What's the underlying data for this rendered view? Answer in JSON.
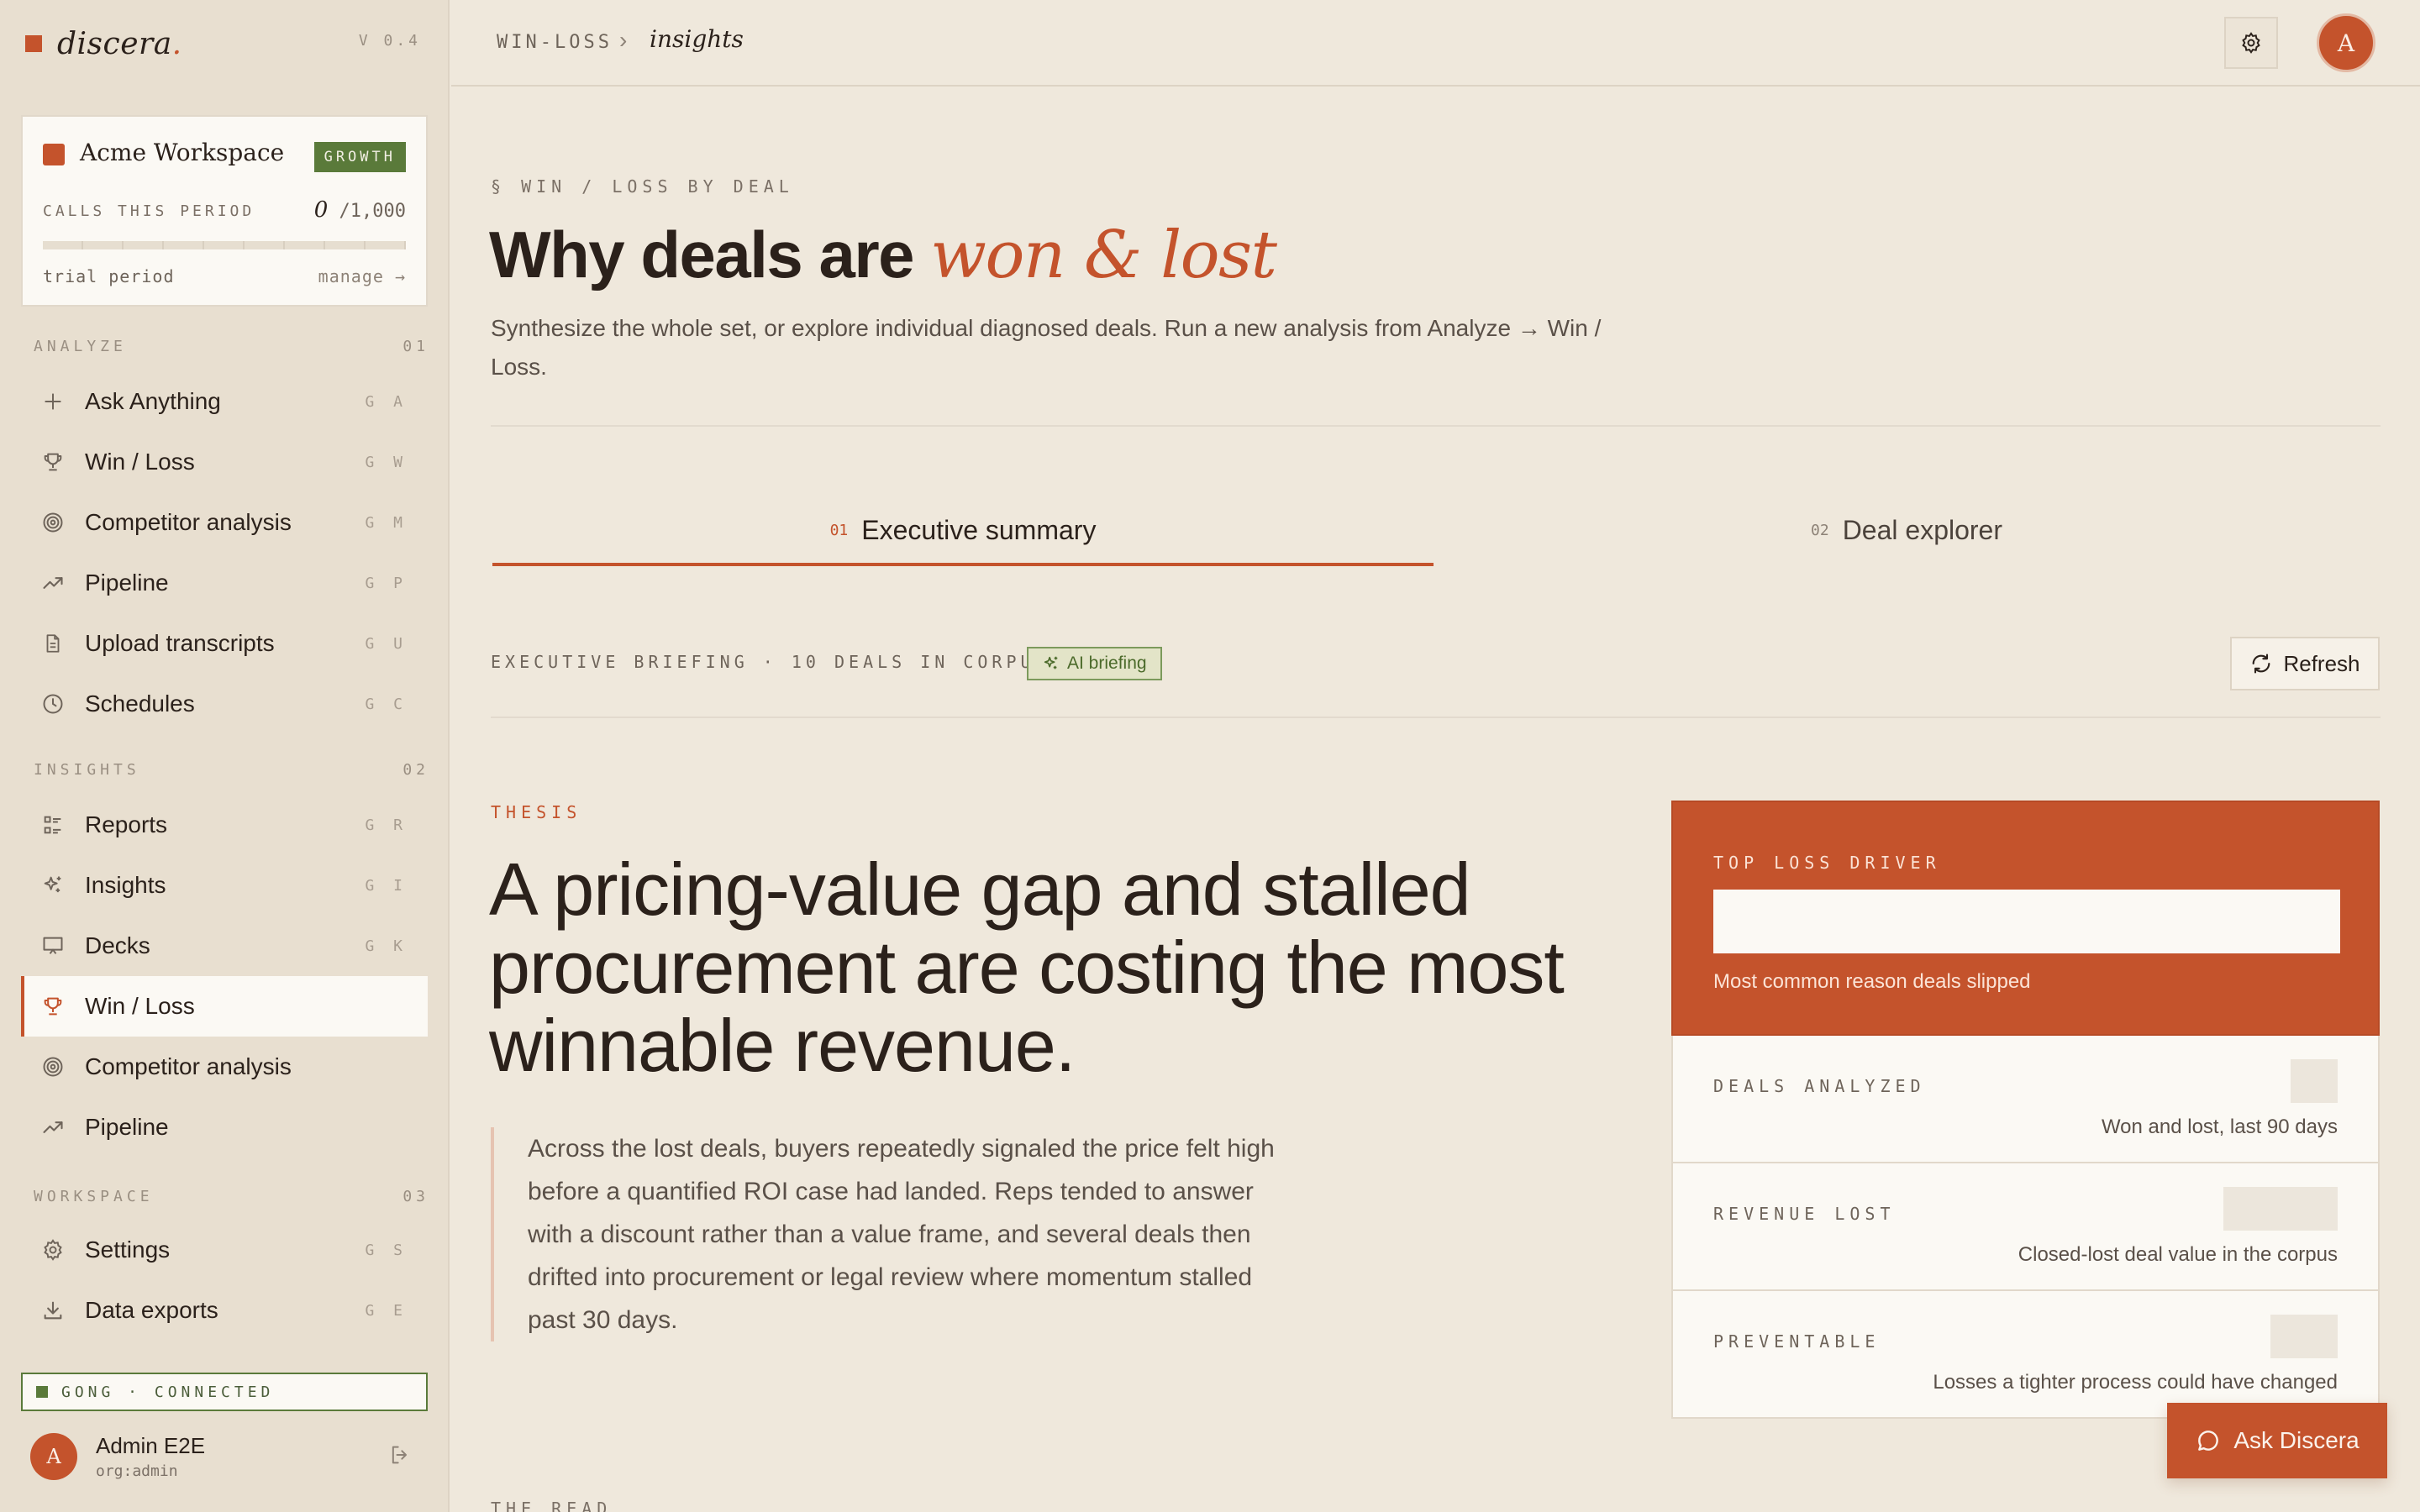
{
  "brand": {
    "name": "discera",
    "dot": ".",
    "version": "V 0.4"
  },
  "workspace": {
    "name": "Acme Workspace",
    "plan": "GROWTH",
    "calls_label": "CALLS THIS PERIOD",
    "calls_used": "0",
    "calls_limit": "/1,000",
    "calls_fraction": 0,
    "trial": "trial period",
    "manage": "manage →"
  },
  "sidebar": {
    "sections": [
      {
        "title": "ANALYZE",
        "num": "01"
      },
      {
        "title": "INSIGHTS",
        "num": "02"
      },
      {
        "title": "WORKSPACE",
        "num": "03"
      }
    ],
    "items": [
      {
        "label": "Ask Anything",
        "key": "G A",
        "icon": "plus-icon"
      },
      {
        "label": "Win / Loss",
        "key": "G W",
        "icon": "trophy-icon"
      },
      {
        "label": "Competitor analysis",
        "key": "G M",
        "icon": "target-icon"
      },
      {
        "label": "Pipeline",
        "key": "G P",
        "icon": "trend-up-icon"
      },
      {
        "label": "Upload transcripts",
        "key": "G U",
        "icon": "document-icon"
      },
      {
        "label": "Schedules",
        "key": "G C",
        "icon": "clock-icon"
      },
      {
        "label": "Reports",
        "key": "G R",
        "icon": "list-icon"
      },
      {
        "label": "Insights",
        "key": "G I",
        "icon": "sparkle-icon"
      },
      {
        "label": "Decks",
        "key": "G K",
        "icon": "presentation-icon"
      },
      {
        "label": "Win / Loss",
        "key": "",
        "icon": "trophy-icon",
        "active": true
      },
      {
        "label": "Competitor analysis",
        "key": "",
        "icon": "target-icon"
      },
      {
        "label": "Pipeline",
        "key": "",
        "icon": "trend-up-icon"
      },
      {
        "label": "Settings",
        "key": "G S",
        "icon": "gear-icon"
      },
      {
        "label": "Data exports",
        "key": "G E",
        "icon": "download-icon"
      }
    ],
    "integration": "GONG · CONNECTED",
    "user": {
      "initial": "A",
      "name": "Admin E2E",
      "org": "org:admin"
    }
  },
  "topbar": {
    "crumb_root": "WIN-LOSS",
    "crumb_sep": "›",
    "crumb_leaf": "insights",
    "avatar_initial": "A"
  },
  "page": {
    "eyebrow": "§ WIN / LOSS BY DEAL",
    "title_plain": "Why deals are ",
    "title_accent": "won & lost",
    "subtitle": "Synthesize the whole set, or explore individual diagnosed deals. Run a new analysis from Analyze → Win / Loss."
  },
  "tabs": [
    {
      "num": "01",
      "label": "Executive summary",
      "active": true
    },
    {
      "num": "02",
      "label": "Deal explorer",
      "active": false
    }
  ],
  "briefing": {
    "label": "EXECUTIVE BRIEFING · 10 DEALS IN CORPUS",
    "badge": "AI briefing",
    "refresh": "Refresh"
  },
  "thesis": {
    "label": "THESIS",
    "headline": "A pricing-value gap and stalled procurement are costing the most winnable revenue.",
    "quote": "Across the lost deals, buyers repeatedly signaled the price felt high before a quantified ROI case had landed. Reps tended to answer with a discount rather than a value frame, and several deals then drifted into procurement or legal review where momentum stalled past 30 days."
  },
  "kpis": {
    "top": {
      "label": "TOP LOSS DRIVER",
      "caption": "Most common reason deals slipped"
    },
    "rows": [
      {
        "label": "DEALS ANALYZED",
        "caption": "Won and lost, last 90 days"
      },
      {
        "label": "REVENUE LOST",
        "caption": "Closed-lost deal value in the corpus"
      },
      {
        "label": "PREVENTABLE",
        "caption": "Losses a tighter process could have changed"
      }
    ]
  },
  "next_section": "THE READ",
  "ask_button": "Ask Discera",
  "colors": {
    "accent": "#c4532c",
    "green": "#5a7a3a",
    "bg": "#efe8dc",
    "sidebar": "#e8dfd0"
  }
}
